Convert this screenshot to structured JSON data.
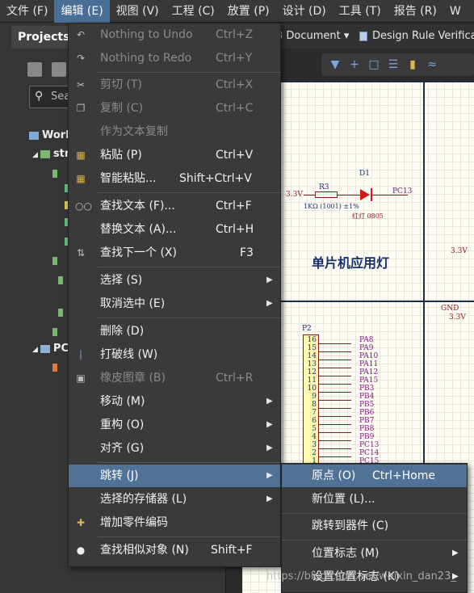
{
  "menubar": {
    "items": [
      {
        "label": "文件 (F)"
      },
      {
        "label": "编辑 (E)"
      },
      {
        "label": "视图 (V)"
      },
      {
        "label": "工程 (C)"
      },
      {
        "label": "放置 (P)"
      },
      {
        "label": "设计 (D)"
      },
      {
        "label": "工具 (T)"
      },
      {
        "label": "报告 (R)"
      },
      {
        "label": "W"
      }
    ]
  },
  "projects_panel": {
    "title": "Projects",
    "search_placeholder": "Sea",
    "tree": [
      {
        "label": "Work"
      },
      {
        "label": "stm"
      },
      {
        "label": "PC"
      }
    ]
  },
  "doc_tabs": [
    {
      "label": "3 Document ▾"
    },
    {
      "label": "Design Rule Verificat"
    }
  ],
  "schematic": {
    "title": "单片机应用灯",
    "led_designator": "D1",
    "led_value": "红灯 0805",
    "resistor_designator": "R3",
    "resistor_value": "1KΩ (1001) ±1%",
    "net_left": "3.3V",
    "net_pc13": "PC13",
    "net_right_1": "3.3V",
    "net_right_2": "GND",
    "net_right_3": "3.3V",
    "connector_designator": "P2",
    "pins": [
      {
        "num": "16",
        "name": "PA8"
      },
      {
        "num": "15",
        "name": "PA9"
      },
      {
        "num": "14",
        "name": "PA10"
      },
      {
        "num": "13",
        "name": "PA11"
      },
      {
        "num": "12",
        "name": "PA12"
      },
      {
        "num": "11",
        "name": "PA15"
      },
      {
        "num": "10",
        "name": "PB3"
      },
      {
        "num": "9",
        "name": "PB4"
      },
      {
        "num": "8",
        "name": "PB5"
      },
      {
        "num": "7",
        "name": "PB6"
      },
      {
        "num": "6",
        "name": "PB7"
      },
      {
        "num": "5",
        "name": "PB8"
      },
      {
        "num": "4",
        "name": "PB9"
      },
      {
        "num": "3",
        "name": "PC13"
      },
      {
        "num": "2",
        "name": "PC14"
      },
      {
        "num": "1",
        "name": "PC15"
      }
    ]
  },
  "edit_menu": {
    "items": [
      {
        "label": "Nothing to Undo",
        "shortcut": "Ctrl+Z"
      },
      {
        "label": "Nothing to Redo",
        "shortcut": "Ctrl+Y"
      },
      {
        "label": "剪切 (T)",
        "shortcut": "Ctrl+X"
      },
      {
        "label": "复制 (C)",
        "shortcut": "Ctrl+C"
      },
      {
        "label": "作为文本复制",
        "shortcut": ""
      },
      {
        "label": "粘贴 (P)",
        "shortcut": "Ctrl+V"
      },
      {
        "label": "智能粘贴...",
        "shortcut": "Shift+Ctrl+V"
      },
      {
        "label": "查找文本 (F)...",
        "shortcut": "Ctrl+F"
      },
      {
        "label": "替换文本 (A)...",
        "shortcut": "Ctrl+H"
      },
      {
        "label": "查找下一个 (X)",
        "shortcut": "F3"
      },
      {
        "label": "选择 (S)",
        "shortcut": ""
      },
      {
        "label": "取消选中 (E)",
        "shortcut": ""
      },
      {
        "label": "删除 (D)",
        "shortcut": ""
      },
      {
        "label": "打破线 (W)",
        "shortcut": ""
      },
      {
        "label": "橡皮图章 (B)",
        "shortcut": "Ctrl+R"
      },
      {
        "label": "移动 (M)",
        "shortcut": ""
      },
      {
        "label": "重构 (O)",
        "shortcut": ""
      },
      {
        "label": "对齐 (G)",
        "shortcut": ""
      },
      {
        "label": "跳转 (J)",
        "shortcut": ""
      },
      {
        "label": "选择的存储器 (L)",
        "shortcut": ""
      },
      {
        "label": "增加零件编码",
        "shortcut": ""
      },
      {
        "label": "查找相似对象 (N)",
        "shortcut": "Shift+F"
      }
    ]
  },
  "jump_submenu": {
    "items": [
      {
        "label": "原点 (O)",
        "shortcut": "Ctrl+Home"
      },
      {
        "label": "新位置 (L)...",
        "shortcut": ""
      },
      {
        "label": "跳转到器件 (C)",
        "shortcut": ""
      },
      {
        "label": "位置标志 (M)",
        "shortcut": ""
      },
      {
        "label": "设置位置标志 (K)",
        "shortcut": ""
      }
    ]
  },
  "watermark": "https://blog.csdn.net/weixin_dan23_"
}
